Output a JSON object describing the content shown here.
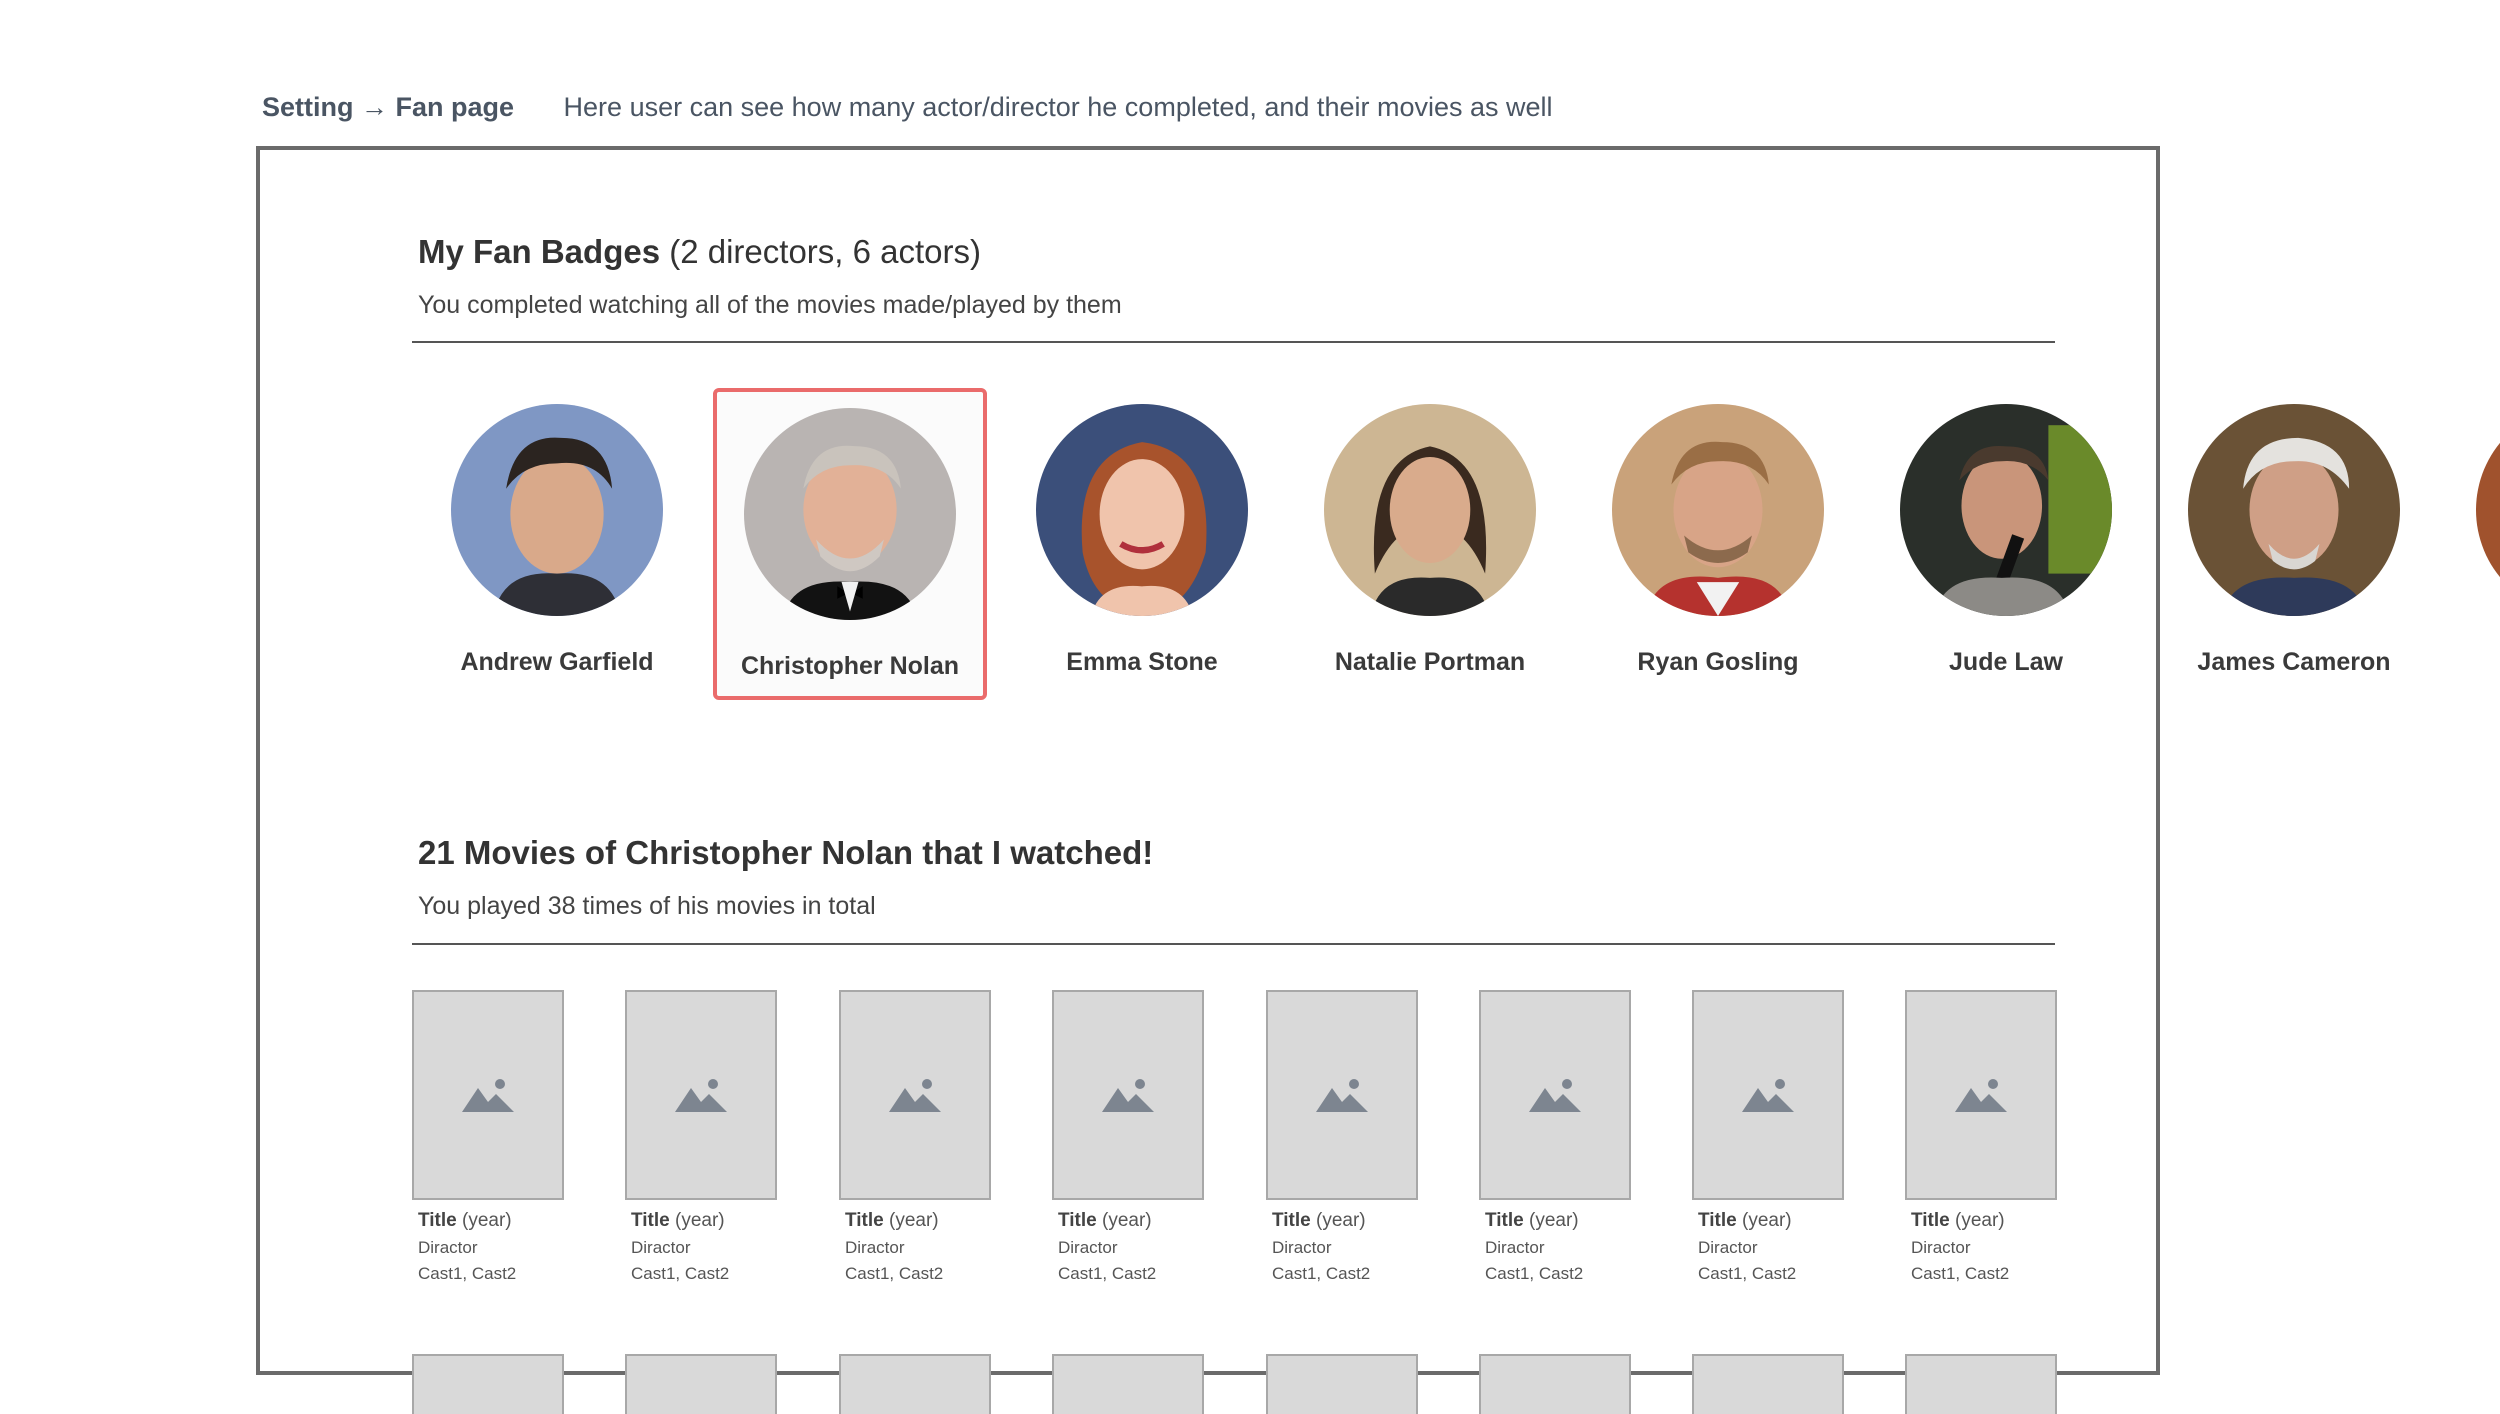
{
  "caption": {
    "crumb": "Setting → Fan page",
    "description": "Here user can see how many actor/director he completed, and their movies as well"
  },
  "badges_section": {
    "title_bold": "My Fan Badges",
    "title_rest": "(2 directors, 6 actors)",
    "subtitle": "You completed watching all of the movies made/played by them"
  },
  "badges": [
    {
      "name": "Andrew Garfield",
      "selected": false
    },
    {
      "name": "Christopher Nolan",
      "selected": true
    },
    {
      "name": "Emma Stone",
      "selected": false
    },
    {
      "name": "Natalie Portman",
      "selected": false
    },
    {
      "name": "Ryan Gosling",
      "selected": false
    },
    {
      "name": "Jude Law",
      "selected": false
    },
    {
      "name": "James Cameron",
      "selected": false
    }
  ],
  "movies_section": {
    "title": "21 Movies of Christopher Nolan that I watched!",
    "subtitle": "You played 38 times of his movies in total"
  },
  "movie_card": {
    "title": "Title",
    "year": "(year)",
    "director": "Diractor",
    "cast": "Cast1, Cast2"
  },
  "colors": {
    "selected_border": "#ea6b6b",
    "frame_border": "#6b6b6b",
    "poster_fill": "#d9d9d9",
    "placeholder_icon": "#7d8590"
  },
  "icons": {
    "poster_placeholder": "image-placeholder-icon"
  }
}
